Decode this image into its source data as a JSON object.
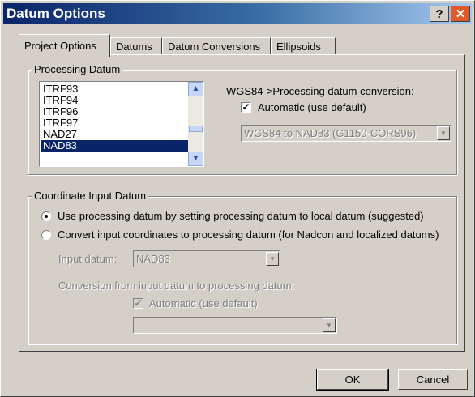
{
  "window": {
    "title": "Datum Options"
  },
  "titlebar": {
    "help_glyph": "?",
    "close_glyph": "✕"
  },
  "tabs": [
    {
      "label": "Project Options",
      "active": true
    },
    {
      "label": "Datums"
    },
    {
      "label": "Datum Conversions"
    },
    {
      "label": "Ellipsoids"
    }
  ],
  "processing_datum": {
    "legend": "Processing Datum",
    "items": [
      "ITRF93",
      "ITRF94",
      "ITRF96",
      "ITRF97",
      "NAD27",
      "NAD83"
    ],
    "selected": "NAD83",
    "conversion_label": "WGS84->Processing datum conversion:",
    "automatic_label": "Automatic (use default)",
    "automatic_checked": true,
    "conversion_value": "WGS84 to NAD83 (G1150-CORS96)"
  },
  "coordinate_input": {
    "legend": "Coordinate Input Datum",
    "option_use_processing": "Use processing datum by setting processing datum to local datum (suggested)",
    "option_convert": "Convert input coordinates to processing datum (for Nadcon and localized datums)",
    "selected_option": "use_processing",
    "input_datum_label": "Input datum:",
    "input_datum_value": "NAD83",
    "conversion_label": "Conversion from input datum to processing datum:",
    "automatic_label": "Automatic (use default)",
    "automatic_checked": true,
    "conversion_value": ""
  },
  "buttons": {
    "ok": "OK",
    "cancel": "Cancel"
  }
}
